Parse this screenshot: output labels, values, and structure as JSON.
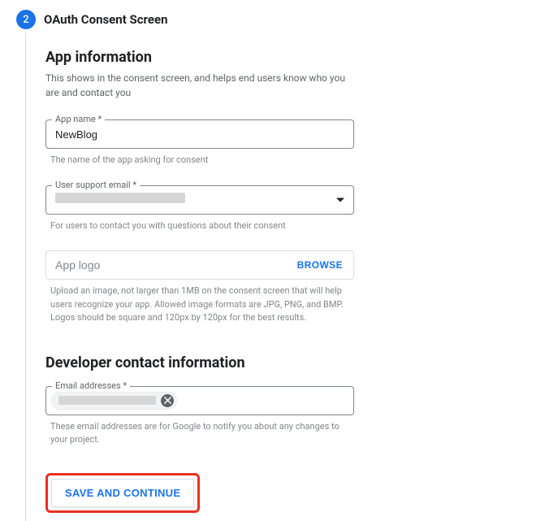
{
  "stepper": {
    "number": "2",
    "title": "OAuth Consent Screen"
  },
  "app_info": {
    "title": "App information",
    "description": "This shows in the consent screen, and helps end users know who you are and contact you",
    "app_name": {
      "label": "App name *",
      "value": "NewBlog",
      "helper": "The name of the app asking for consent"
    },
    "support_email": {
      "label": "User support email *",
      "helper": "For users to contact you with questions about their consent"
    },
    "app_logo": {
      "placeholder": "App logo",
      "browse": "BROWSE",
      "helper": "Upload an image, not larger than 1MB on the consent screen that will help users recognize your app. Allowed image formats are JPG, PNG, and BMP. Logos should be square and 120px by 120px for the best results."
    }
  },
  "dev_contact": {
    "title": "Developer contact information",
    "email_label": "Email addresses *",
    "helper": "These email addresses are for Google to notify you about any changes to your project."
  },
  "actions": {
    "save": "SAVE AND CONTINUE"
  }
}
